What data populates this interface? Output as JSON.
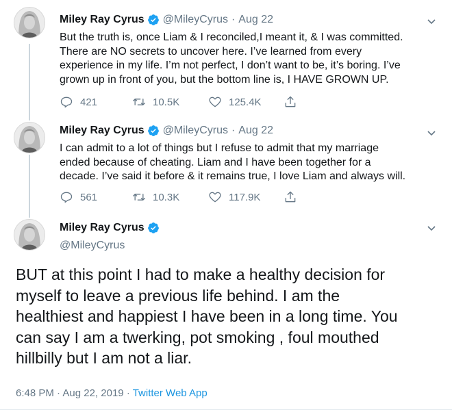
{
  "colors": {
    "accent": "#1da1f2",
    "link": "#1b95e0",
    "muted": "#657786",
    "text": "#14171a"
  },
  "icons": [
    "avatar",
    "verified-badge-icon",
    "caret-down-icon",
    "reply-icon",
    "retweet-icon",
    "like-icon",
    "share-icon"
  ],
  "tweets": [
    {
      "name": "Miley Ray Cyrus",
      "handle": "@MileyCyrus",
      "separator": "·",
      "date": "Aug 22",
      "lines": [
        "But the truth is, once Liam & I reconciled,I meant it, & I was committed.",
        "There are NO secrets to uncover here. I’ve learned from every",
        "experience in my life. I’m not perfect, I don’t want to be, it’s boring. I’ve",
        "grown up in front of you, but the bottom line is, I HAVE GROWN UP."
      ],
      "replies": "421",
      "retweets": "10.5K",
      "likes": "125.4K"
    },
    {
      "name": "Miley Ray Cyrus",
      "handle": "@MileyCyrus",
      "separator": "·",
      "date": "Aug 22",
      "lines": [
        "I can admit to a lot of things but I refuse to admit that my marriage",
        "ended because of cheating. Liam and I have been together for a",
        "decade. I’ve said it before & it remains true, I love Liam and always will."
      ],
      "replies": "561",
      "retweets": "10.3K",
      "likes": "117.9K"
    }
  ],
  "main_tweet": {
    "name": "Miley Ray Cyrus",
    "handle": "@MileyCyrus",
    "lines": [
      "BUT at this point I had to make a healthy decision for",
      "myself to leave a previous life behind. I am the",
      "healthiest and happiest I have been in a long time.  You",
      "can say I am a twerking, pot smoking , foul mouthed",
      "hillbilly but I am not a liar."
    ],
    "time": "6:48 PM",
    "separator": "·",
    "full_date": "Aug 22, 2019",
    "separator2": "·",
    "source": "Twitter Web App"
  }
}
